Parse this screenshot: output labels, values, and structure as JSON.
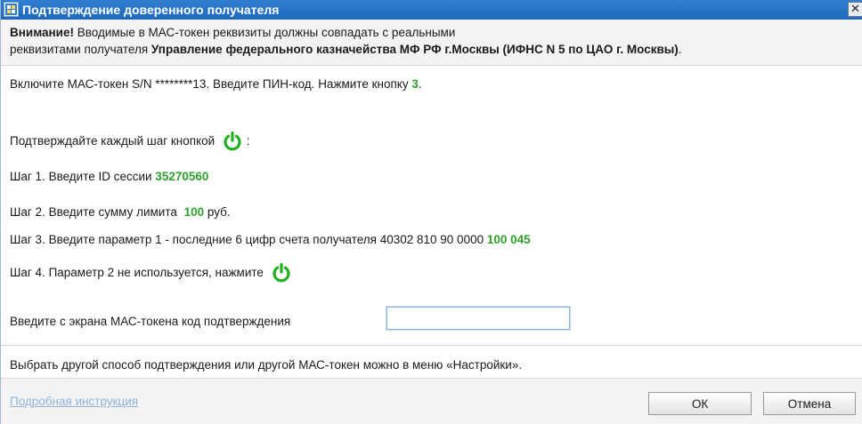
{
  "window": {
    "title": "Подтверждение доверенного получателя",
    "close_glyph": "✕"
  },
  "warning": {
    "bold_prefix": "Внимание!",
    "text_line1": " Вводимые в МАС-токен реквизиты должны совпадать с реальными",
    "text_line2": "реквизитами получателя ",
    "recipient": "Управление федерального казначейства МФ РФ г.Москвы (ИФНС N 5 по ЦАО г. Москвы)",
    "text_end": "."
  },
  "instructions": {
    "enable_token": {
      "text": "Включите МАС-токен S/N ********13. Введите ПИН-код. Нажмите кнопку ",
      "key": "3",
      "end": "."
    },
    "confirm_each_step": {
      "text": "Подтверждайте каждый шаг кнопкой",
      "end": ":"
    },
    "step1": {
      "text": "Шаг 1. Введите ID сессии ",
      "value": "35270560"
    },
    "step2": {
      "text": "Шаг 2. Введите сумму лимита ",
      "value": "100",
      "unit": " руб."
    },
    "step3": {
      "text": "Шаг 3. Введите параметр 1 - последние 6 цифр счета получателя 40302 810 90 0000 ",
      "value": "100 045"
    },
    "step4": {
      "text": "Шаг 4. Параметр 2 не используется, нажмите"
    }
  },
  "confirmation": {
    "label": "Введите с экрана МАС-токена код подтверждения",
    "value": "",
    "placeholder": ""
  },
  "settings_note": "Выбрать другой способ подтверждения или другой МАС-токен можно в меню «Настройки».",
  "footer": {
    "help_link": "Подробная инструкция",
    "ok_label": "ОК",
    "cancel_label": "Отмена"
  },
  "colors": {
    "accent_green": "#2ea12e",
    "titlebar_blue": "#1f67bd",
    "link": "#8fb3d7"
  },
  "icons": {
    "power": "power-icon",
    "app": "app-icon"
  }
}
